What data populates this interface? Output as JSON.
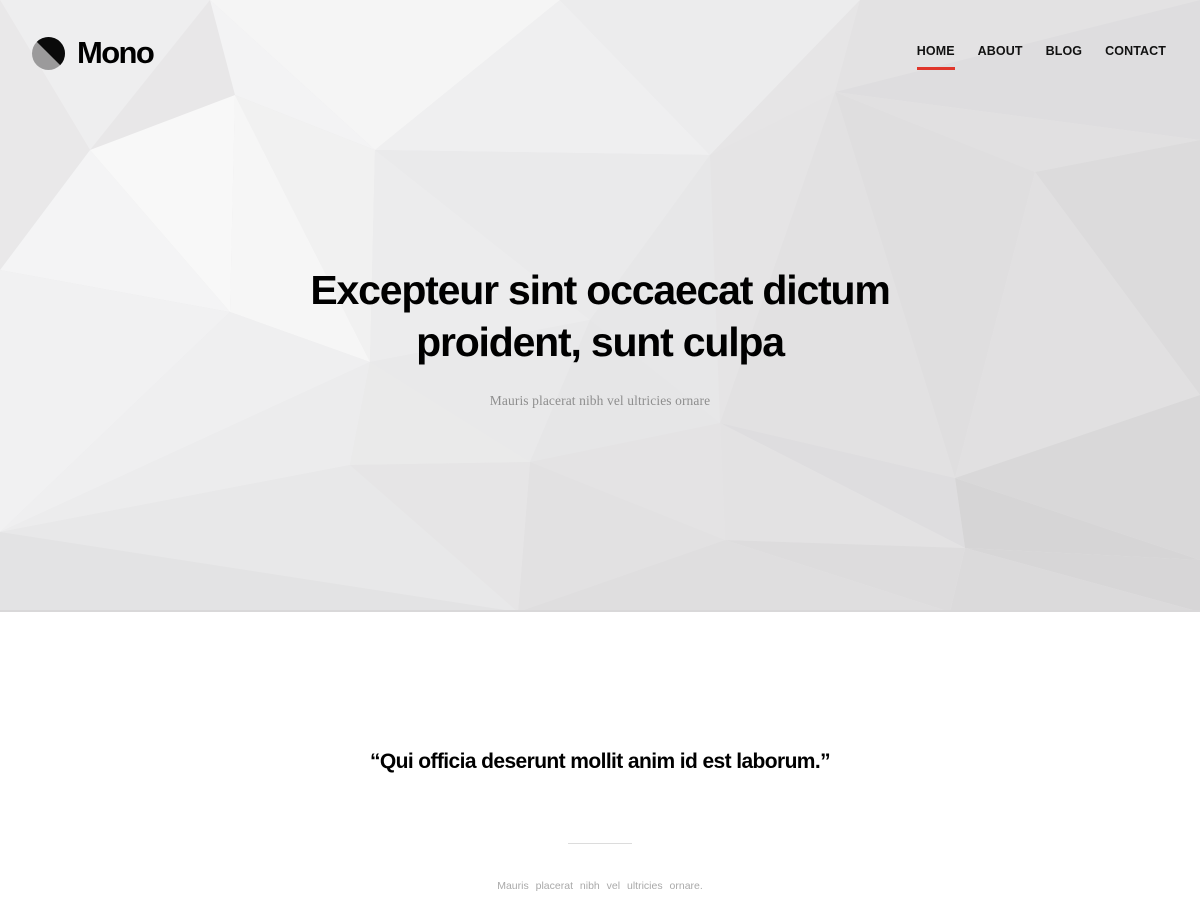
{
  "header": {
    "logo": {
      "text": "Mono",
      "icon": "half-circle-logo-icon"
    },
    "nav": {
      "items": [
        {
          "label": "HOME",
          "active": true
        },
        {
          "label": "ABOUT",
          "active": false
        },
        {
          "label": "BLOG",
          "active": false
        },
        {
          "label": "CONTACT",
          "active": false
        }
      ],
      "active_color": "#e0362b"
    }
  },
  "hero": {
    "title": "Excepteur sint occaecat dictum proident, sunt culpa",
    "subtitle": "Mauris placerat nibh vel ultricies ornare",
    "background": "low-poly-light-gray"
  },
  "quote": {
    "text": "“Qui officia deserunt mollit anim id est laborum.”",
    "caption": "Mauris placerat nibh vel ultricies ornare."
  },
  "colors": {
    "accent": "#e0362b",
    "text": "#000000",
    "muted": "#8e8e8e",
    "page_background": "#ffffff"
  }
}
